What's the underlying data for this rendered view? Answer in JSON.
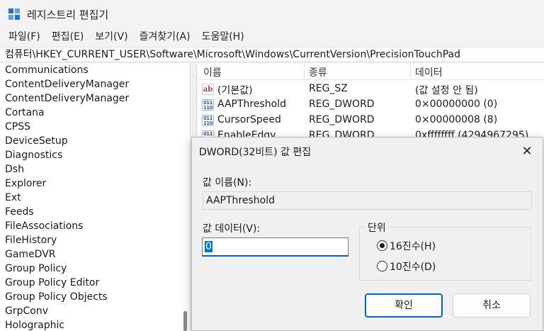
{
  "window": {
    "title": "레지스트리 편집기"
  },
  "menu": [
    "파일(F)",
    "편집(E)",
    "보기(V)",
    "즐겨찾기(A)",
    "도움말(H)"
  ],
  "address": "컴퓨터\\HKEY_CURRENT_USER\\Software\\Microsoft\\Windows\\CurrentVersion\\PrecisionTouchPad",
  "tree": [
    "Communications",
    "ContentDeliveryManager",
    "ContentDeliveryManager",
    "Cortana",
    "CPSS",
    "DeviceSetup",
    "Diagnostics",
    "Dsh",
    "Explorer",
    "Ext",
    "Feeds",
    "FileAssociations",
    "FileHistory",
    "GameDVR",
    "Group Policy",
    "Group Policy Editor",
    "Group Policy Objects",
    "GrpConv",
    "Holographic"
  ],
  "values_header": {
    "name": "이름",
    "type": "종류",
    "data": "데이터"
  },
  "values": [
    {
      "icon": "string-value-icon",
      "badge": "ab",
      "name": "(기본값)",
      "type": "REG_SZ",
      "data": "(값 설정 안 됨)"
    },
    {
      "icon": "binary-value-icon",
      "badge": "011\n110",
      "name": "AAPThreshold",
      "type": "REG_DWORD",
      "data": "0×00000000 (0)"
    },
    {
      "icon": "binary-value-icon",
      "badge": "011\n110",
      "name": "CursorSpeed",
      "type": "REG_DWORD",
      "data": "0×00000008 (8)"
    },
    {
      "icon": "binary-value-icon",
      "badge": "011\n110",
      "name": "EnableEdgy",
      "type": "REG_DWORD",
      "data": "0xffffffff (4294967295)"
    }
  ],
  "dialog": {
    "title": "DWORD(32비트) 값 편집",
    "close": "✕",
    "name_label": "값 이름(N):",
    "name_value": "AAPThreshold",
    "data_label": "값 데이터(V):",
    "data_value": "0",
    "base_label": "단위",
    "base_hex": "16진수(H)",
    "base_dec": "10진수(D)",
    "base_selected": "hex",
    "ok": "확인",
    "cancel": "취소"
  }
}
